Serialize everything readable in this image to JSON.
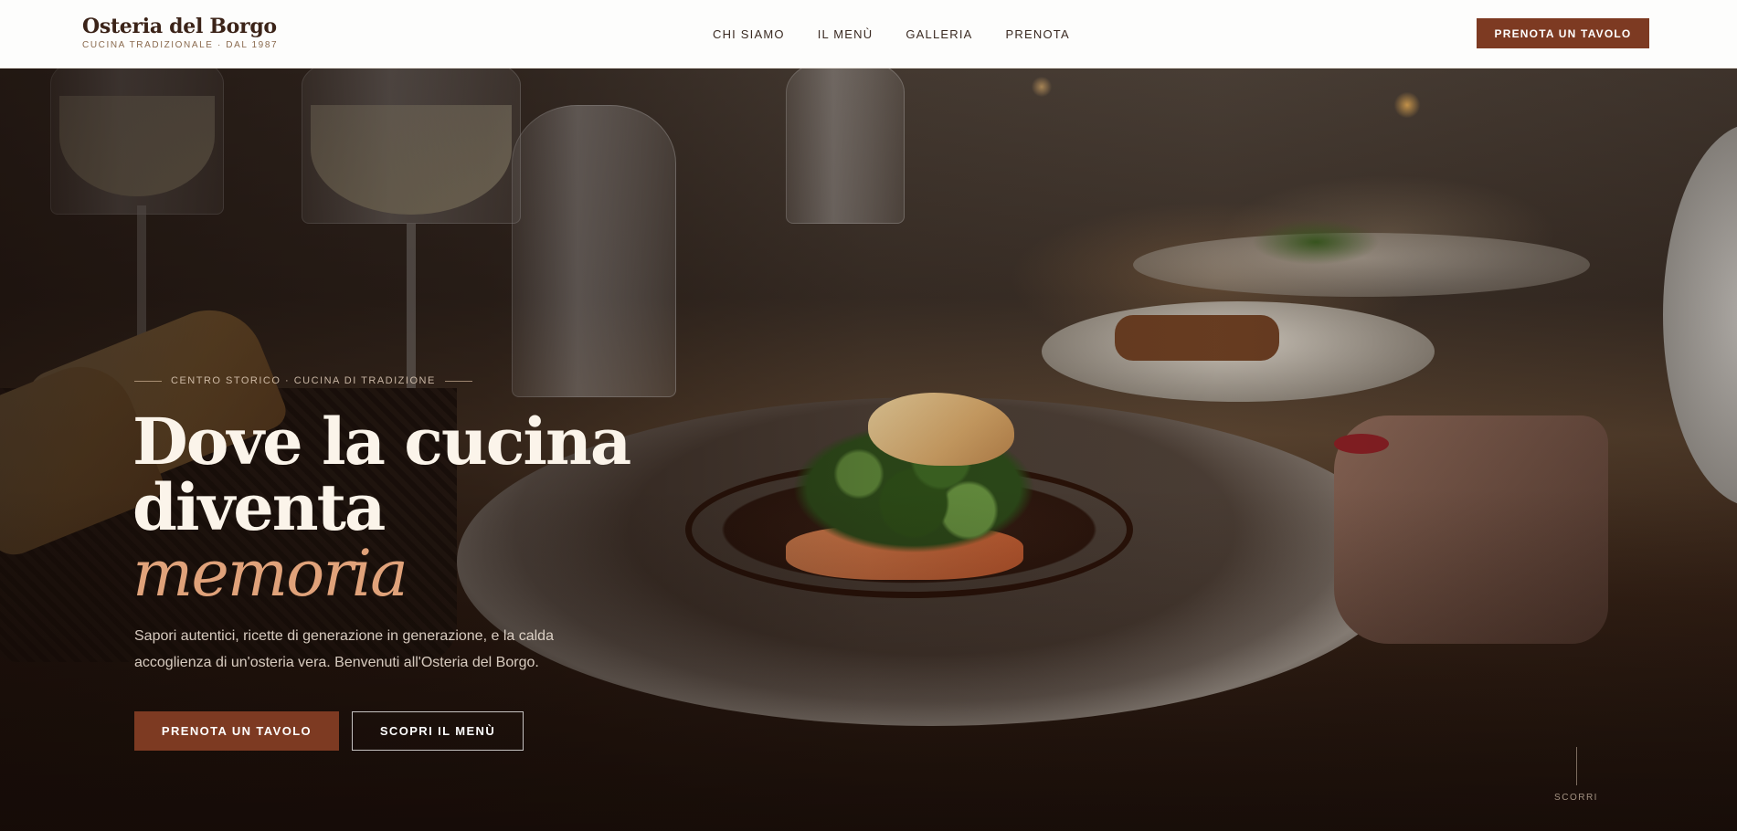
{
  "header": {
    "brand_name": "Osteria del Borgo",
    "brand_tagline": "CUCINA TRADIZIONALE · DAL 1987",
    "nav": [
      {
        "label": "CHI SIAMO"
      },
      {
        "label": "IL MENÙ"
      },
      {
        "label": "GALLERIA"
      },
      {
        "label": "PRENOTA"
      }
    ],
    "cta_label": "PRENOTA UN TAVOLO"
  },
  "hero": {
    "eyebrow": "CENTRO STORICO · CUCINA DI TRADIZIONE",
    "headline_line1": "Dove la cucina",
    "headline_line2": "diventa",
    "headline_accent": "memoria",
    "lede": "Sapori autentici, ricette di generazione in generazione, e la calda accoglienza di un'osteria vera. Benvenuti all'Osteria del Borgo.",
    "primary_button": "PRENOTA UN TAVOLO",
    "secondary_button": "SCOPRI IL MENÙ",
    "scroll_label": "SCORRI"
  },
  "colors": {
    "accent": "#7d3a22",
    "headline_accent": "#e0a27a",
    "header_bg": "#fdfdfc",
    "brand_text": "#3b2318"
  }
}
